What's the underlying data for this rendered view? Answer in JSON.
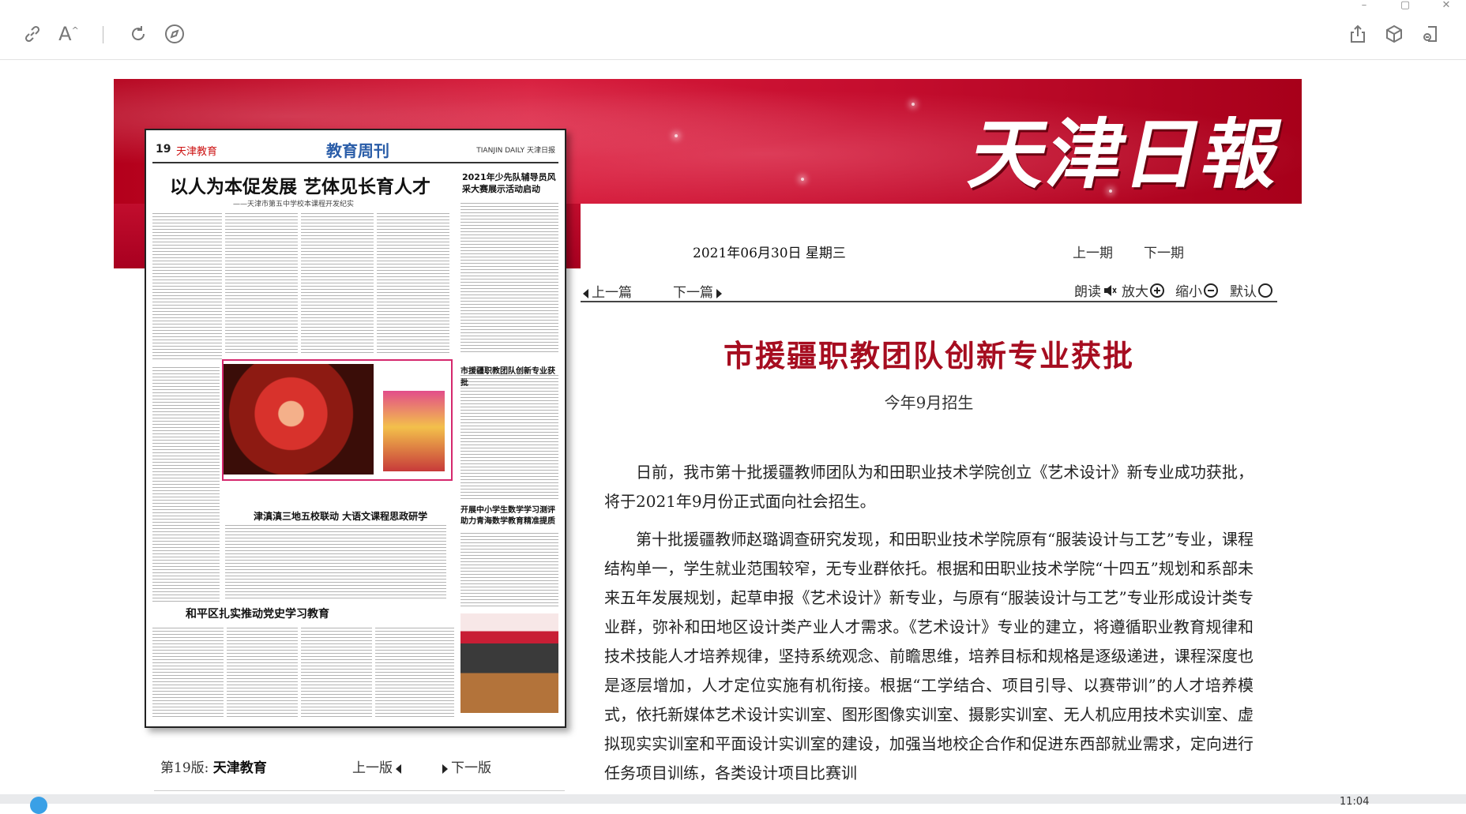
{
  "window": {
    "controls": [
      "–",
      "▢",
      "✕"
    ]
  },
  "toolbar": {
    "icons": [
      "link-icon",
      "text-size-icon",
      "refresh-icon",
      "compass-icon",
      "share-icon",
      "cube-icon",
      "reader-icon"
    ],
    "text_size_label": "A"
  },
  "masthead": {
    "logo": "天津日報"
  },
  "paper": {
    "page_number": "19",
    "page_name": "天津教育",
    "section_title": "教育周刊",
    "brand": "TIANJIN DAILY 天津日报",
    "headline": "以人为本促发展 艺体见长育人才",
    "subheadline": "——天津市第五中学校本课程开发纪实",
    "side_headline": "2021年少先队辅导员风采大赛展示活动启动",
    "mid_headline": "津滇滇三地五校联动 大语文课程思政研学",
    "right_headline": "开展中小学生数学学习测评助力青海数学教育精准提质",
    "bottom_headline": "和平区扎实推动党史学习教育",
    "box_headline": "市援疆职教团队创新专业获批"
  },
  "edition": {
    "label": "第19版:",
    "name": "天津教育",
    "prev": "上一版",
    "next": "下一版"
  },
  "issue": {
    "date": "2021年06月30日  星期三",
    "prev": "上一期",
    "next": "下一期"
  },
  "article_nav": {
    "prev": "上一篇",
    "next": "下一篇"
  },
  "tools": {
    "read": "朗读",
    "zoom_in": "放大",
    "zoom_out": "缩小",
    "default": "默认"
  },
  "article": {
    "title": "市援疆职教团队创新专业获批",
    "subtitle": "今年9月招生",
    "paragraphs": [
      "日前，我市第十批援疆教师团队为和田职业技术学院创立《艺术设计》新专业成功获批，将于2021年9月份正式面向社会招生。",
      "第十批援疆教师赵璐调查研究发现，和田职业技术学院原有“服装设计与工艺”专业，课程结构单一，学生就业范围较窄，无专业群依托。根据和田职业技术学院“十四五”规划和系部未来五年发展规划，起草申报《艺术设计》新专业，与原有“服装设计与工艺”专业形成设计类专业群，弥补和田地区设计类产业人才需求。《艺术设计》专业的建立，将遵循职业教育规律和技术技能人才培养规律，坚持系统观念、前瞻思维，培养目标和规格是逐级递进，课程深度也是逐层增加，人才定位实施有机衔接。根据“工学结合、项目引导、以赛带训”的人才培养模式，依托新媒体艺术设计实训室、图形图像实训室、摄影实训室、无人机应用技术实训室、虚拟现实实训室和平面设计实训室的建设，加强当地校企合作和促进东西部就业需求，定向进行任务项目训练，各类设计项目比赛训"
    ]
  },
  "system": {
    "clock": "11:04"
  }
}
